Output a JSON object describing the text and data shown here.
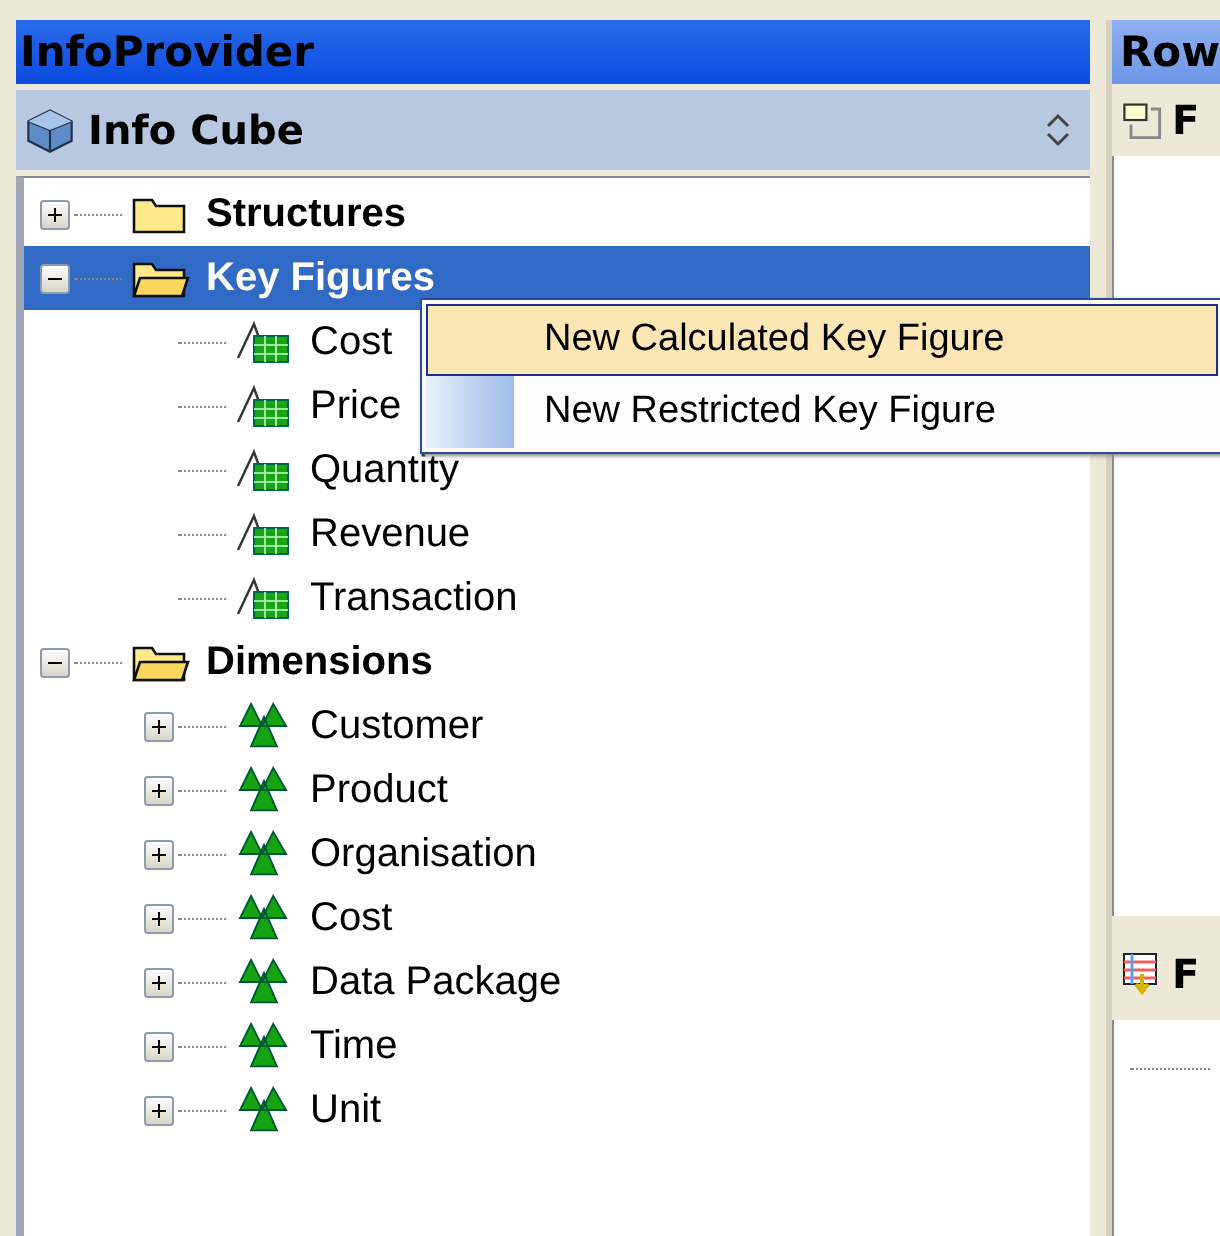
{
  "left_panel": {
    "title": "InfoProvider",
    "subtitle": "Info Cube"
  },
  "tree": [
    {
      "label": "Structures",
      "kind": "folder",
      "expanded": false,
      "selected": false
    },
    {
      "label": "Key Figures",
      "kind": "folder",
      "expanded": true,
      "selected": true,
      "children": [
        {
          "label": "Cost",
          "kind": "keyfigure",
          "selected": false
        },
        {
          "label": "Price",
          "kind": "keyfigure",
          "selected": false
        },
        {
          "label": "Quantity",
          "kind": "keyfigure",
          "selected": false
        },
        {
          "label": "Revenue",
          "kind": "keyfigure",
          "selected": false
        },
        {
          "label": "Transaction",
          "kind": "keyfigure",
          "selected": false
        }
      ]
    },
    {
      "label": "Dimensions",
      "kind": "folder",
      "expanded": true,
      "selected": false,
      "children": [
        {
          "label": "Customer",
          "kind": "dimension",
          "expanded": false,
          "selected": false
        },
        {
          "label": "Product",
          "kind": "dimension",
          "expanded": false,
          "selected": false
        },
        {
          "label": "Organisation",
          "kind": "dimension",
          "expanded": false,
          "selected": false
        },
        {
          "label": "Cost",
          "kind": "dimension",
          "expanded": false,
          "selected": false
        },
        {
          "label": "Data Package",
          "kind": "dimension",
          "expanded": false,
          "selected": false
        },
        {
          "label": "Time",
          "kind": "dimension",
          "expanded": false,
          "selected": false
        },
        {
          "label": "Unit",
          "kind": "dimension",
          "expanded": false,
          "selected": false
        }
      ]
    }
  ],
  "context_menu": [
    {
      "label": "New Calculated Key Figure",
      "selected": true
    },
    {
      "label": "New Restricted Key Figure",
      "selected": false
    }
  ],
  "right_panel": {
    "title": "Row",
    "toolbar_label": "F",
    "lower_label": "F"
  }
}
